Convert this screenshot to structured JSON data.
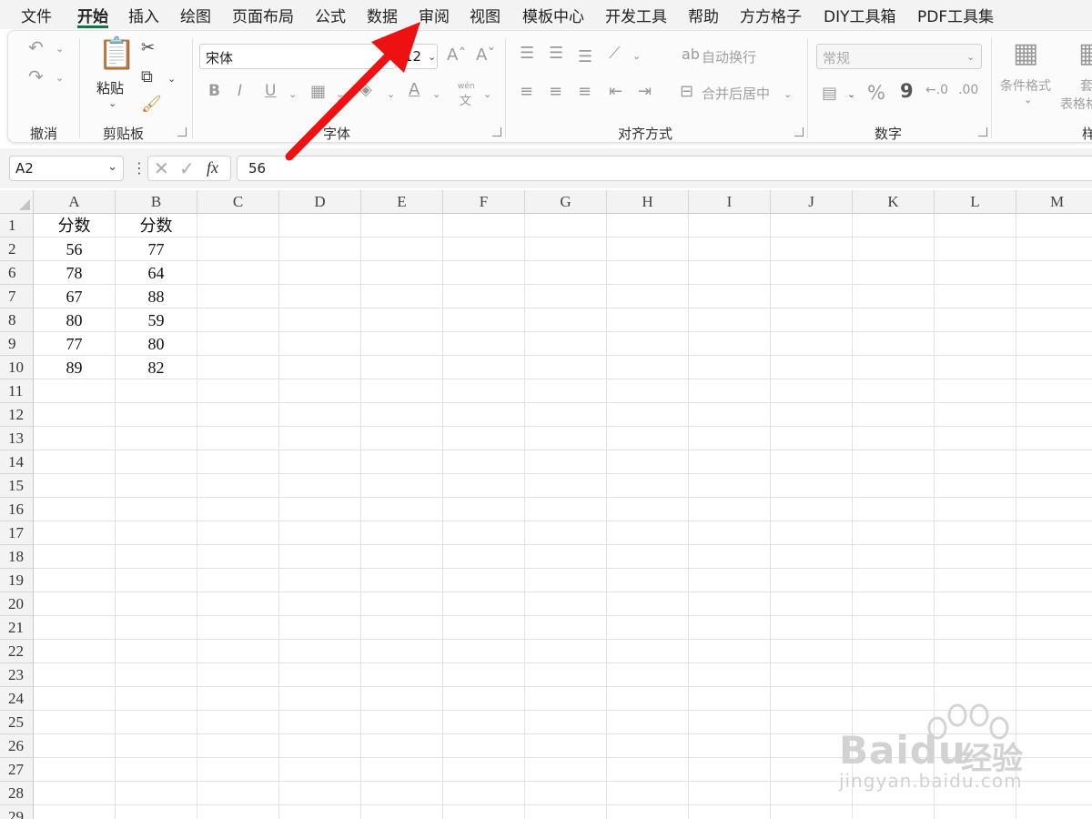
{
  "menubar": {
    "items": [
      "文件",
      "开始",
      "插入",
      "绘图",
      "页面布局",
      "公式",
      "数据",
      "审阅",
      "视图",
      "模板中心",
      "开发工具",
      "帮助",
      "方方格子",
      "DIY工具箱",
      "PDF工具集"
    ],
    "active_index": 1
  },
  "ribbon": {
    "undo_group_label": "撤消",
    "clipboard": {
      "paste_label": "粘贴",
      "group_label": "剪贴板"
    },
    "font": {
      "font_name": "宋体",
      "font_size": "12",
      "group_label": "字体",
      "pinyin_top": "wén",
      "pinyin_bottom": "文"
    },
    "alignment": {
      "wrap_label": "自动换行",
      "merge_label": "合并后居中",
      "group_label": "对齐方式"
    },
    "number": {
      "format_value": "常规",
      "percent": "%",
      "comma": "9",
      "group_label": "数字"
    },
    "styles": {
      "conditional_label": "条件格式",
      "table_label_top": "套",
      "table_label_bottom": "表格格",
      "group_label": "样"
    }
  },
  "formula_bar": {
    "name_box": "A2",
    "fx_label": "fx",
    "formula_value": "56"
  },
  "sheet": {
    "columns": [
      "A",
      "B",
      "C",
      "D",
      "E",
      "F",
      "G",
      "H",
      "I",
      "J",
      "K",
      "L",
      "M"
    ],
    "rows": [
      {
        "num": "1",
        "cells": [
          "分数",
          "分数"
        ]
      },
      {
        "num": "2",
        "cells": [
          "56",
          "77"
        ]
      },
      {
        "num": "6",
        "cells": [
          "78",
          "64"
        ]
      },
      {
        "num": "7",
        "cells": [
          "67",
          "88"
        ]
      },
      {
        "num": "8",
        "cells": [
          "80",
          "59"
        ]
      },
      {
        "num": "9",
        "cells": [
          "77",
          "80"
        ]
      },
      {
        "num": "10",
        "cells": [
          "89",
          "82"
        ]
      },
      {
        "num": "11",
        "cells": [
          "",
          ""
        ]
      },
      {
        "num": "12",
        "cells": [
          "",
          ""
        ]
      },
      {
        "num": "13",
        "cells": [
          "",
          ""
        ]
      },
      {
        "num": "14",
        "cells": [
          "",
          ""
        ]
      },
      {
        "num": "15",
        "cells": [
          "",
          ""
        ]
      },
      {
        "num": "16",
        "cells": [
          "",
          ""
        ]
      },
      {
        "num": "17",
        "cells": [
          "",
          ""
        ]
      },
      {
        "num": "18",
        "cells": [
          "",
          ""
        ]
      },
      {
        "num": "19",
        "cells": [
          "",
          ""
        ]
      },
      {
        "num": "20",
        "cells": [
          "",
          ""
        ]
      },
      {
        "num": "21",
        "cells": [
          "",
          ""
        ]
      },
      {
        "num": "22",
        "cells": [
          "",
          ""
        ]
      },
      {
        "num": "23",
        "cells": [
          "",
          ""
        ]
      },
      {
        "num": "24",
        "cells": [
          "",
          ""
        ]
      },
      {
        "num": "25",
        "cells": [
          "",
          ""
        ]
      },
      {
        "num": "26",
        "cells": [
          "",
          ""
        ]
      },
      {
        "num": "27",
        "cells": [
          "",
          ""
        ]
      },
      {
        "num": "28",
        "cells": [
          "",
          ""
        ]
      },
      {
        "num": "29",
        "cells": [
          "",
          ""
        ]
      }
    ]
  },
  "watermark": {
    "brand": "Baidu",
    "suffix": "经验",
    "url": "jingyan.baidu.com"
  },
  "colors": {
    "accent_green": "#1e7145",
    "arrow_red": "#ee1111"
  }
}
